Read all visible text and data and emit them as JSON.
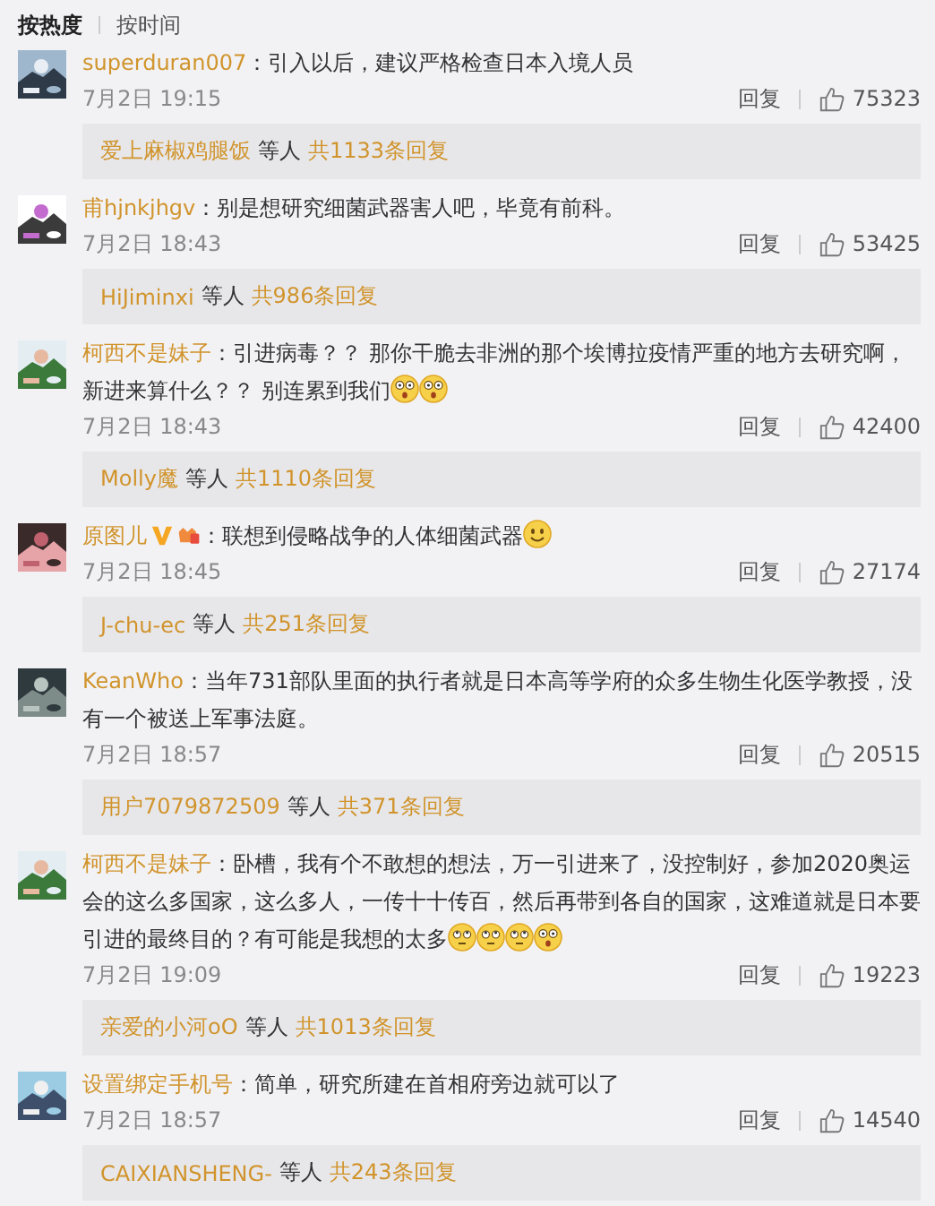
{
  "sort_tabs": [
    {
      "label": "按热度",
      "selected": true
    },
    {
      "label": "按时间",
      "selected": false
    }
  ],
  "comments": [
    {
      "user": "superduran007",
      "text": "：引入以后，建议严格检查日本入境人员",
      "time": "7月2日 19:15",
      "reply_label": "回复",
      "likes": "75323",
      "replies": {
        "user": "爱上麻椒鸡腿饭",
        "joiner": "等人",
        "count": "共1133条回复"
      }
    },
    {
      "user": "甫hjnkjhgv",
      "text": "：别是想研究细菌武器害人吧，毕竟有前科。",
      "time": "7月2日 18:43",
      "reply_label": "回复",
      "likes": "53425",
      "replies": {
        "user": "HiJiminxi",
        "joiner": "等人",
        "count": "共986条回复"
      }
    },
    {
      "user": "柯西不是妹子",
      "text": "：引进病毒？？ 那你干脆去非洲的那个埃博拉疫情严重的地方去研究啊，新进来算什么？？ 别连累到我们",
      "emojis": [
        {
          "kind": "surprised"
        },
        {
          "kind": "surprised"
        }
      ],
      "time": "7月2日 18:43",
      "reply_label": "回复",
      "likes": "42400",
      "replies": {
        "user": "Molly魔",
        "joiner": "等人",
        "count": "共1110条回复"
      }
    },
    {
      "user": "原图儿",
      "verified": true,
      "member": true,
      "text": "：联想到侵略战争的人体细菌武器",
      "emojis": [
        {
          "kind": "smile"
        }
      ],
      "time": "7月2日 18:45",
      "reply_label": "回复",
      "likes": "27174",
      "replies": {
        "user": "J-chu-ec",
        "joiner": "等人",
        "count": "共251条回复"
      }
    },
    {
      "user": "KeanWho",
      "text": "：当年731部队里面的执行者就是日本高等学府的众多生物生化医学教授，没有一个被送上军事法庭。",
      "time": "7月2日 18:57",
      "reply_label": "回复",
      "likes": "20515",
      "replies": {
        "user": "用户7079872509",
        "joiner": "等人",
        "count": "共371条回复"
      }
    },
    {
      "user": "柯西不是妹子",
      "text": "：卧槽，我有个不敢想的想法，万一引进来了，没控制好，参加2020奥运会的这么多国家，这么多人，一传十十传百，然后再带到各自的国家，这难道就是日本要引进的最终目的？有可能是我想的太多",
      "emojis": [
        {
          "kind": "roll"
        },
        {
          "kind": "roll"
        },
        {
          "kind": "roll"
        },
        {
          "kind": "surprised"
        }
      ],
      "time": "7月2日 19:09",
      "reply_label": "回复",
      "likes": "19223",
      "replies": {
        "user": "亲爱的小河oO",
        "joiner": "等人",
        "count": "共1013条回复"
      }
    },
    {
      "user": "设置绑定手机号",
      "text": "：简单，研究所建在首相府旁边就可以了",
      "time": "7月2日 18:57",
      "reply_label": "回复",
      "likes": "14540",
      "replies": {
        "user": "CAIXIANSHENG-",
        "joiner": "等人",
        "count": "共243条回复"
      }
    }
  ]
}
